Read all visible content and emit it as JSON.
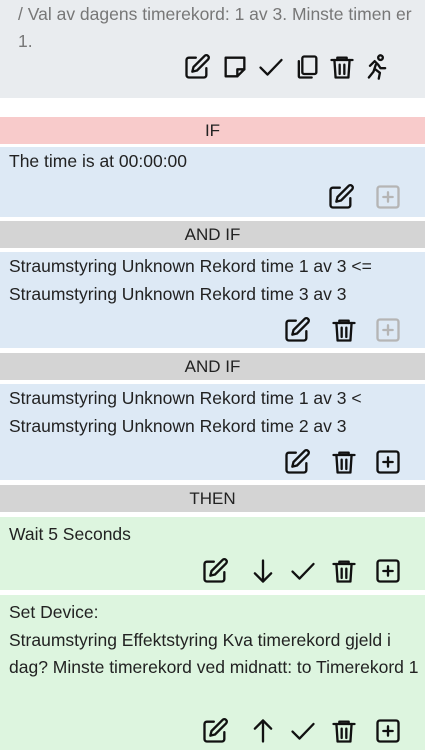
{
  "header": {
    "text": "/  Val av dagens timerekord: 1 av 3. Minste timen er 1."
  },
  "sections": {
    "if_label": "IF",
    "and_if_label": "AND IF",
    "then_label": "THEN"
  },
  "conditions": [
    "The time is at 00:00:00",
    "Straumstyring Unknown Rekord time 1 av 3 <= Straumstyring Unknown Rekord time 3 av 3",
    "Straumstyring Unknown Rekord time 1 av 3 < Straumstyring Unknown Rekord time 2 av 3"
  ],
  "actions": [
    "Wait 5 Seconds",
    "Set Device:\nStraumstyring Effektstyring Kva timerekord gjeld i dag? Minste timerekord ved midnatt: to Timerekord 1"
  ],
  "icons": {
    "header": [
      "edit-icon",
      "note-icon",
      "check-icon",
      "copy-icon",
      "trash-icon",
      "run-icon"
    ],
    "condition_1": [
      "edit-icon",
      "add-box-icon"
    ],
    "condition_2": [
      "edit-icon",
      "trash-icon",
      "add-box-icon"
    ],
    "condition_3": [
      "edit-icon",
      "trash-icon",
      "add-box-icon"
    ],
    "action_1": [
      "edit-icon",
      "arrow-down-icon",
      "check-icon",
      "trash-icon",
      "add-box-icon"
    ],
    "action_2": [
      "edit-icon",
      "arrow-up-icon",
      "check-icon",
      "trash-icon",
      "add-box-icon"
    ]
  },
  "colors": {
    "header_bg": "#e9ecef",
    "if_bar": "#f8cbcb",
    "and_bar": "#d4d4d4",
    "condition_bg": "#dde9f5",
    "action_bg": "#ddf5df",
    "disabled_icon": "#b5b5b5"
  }
}
